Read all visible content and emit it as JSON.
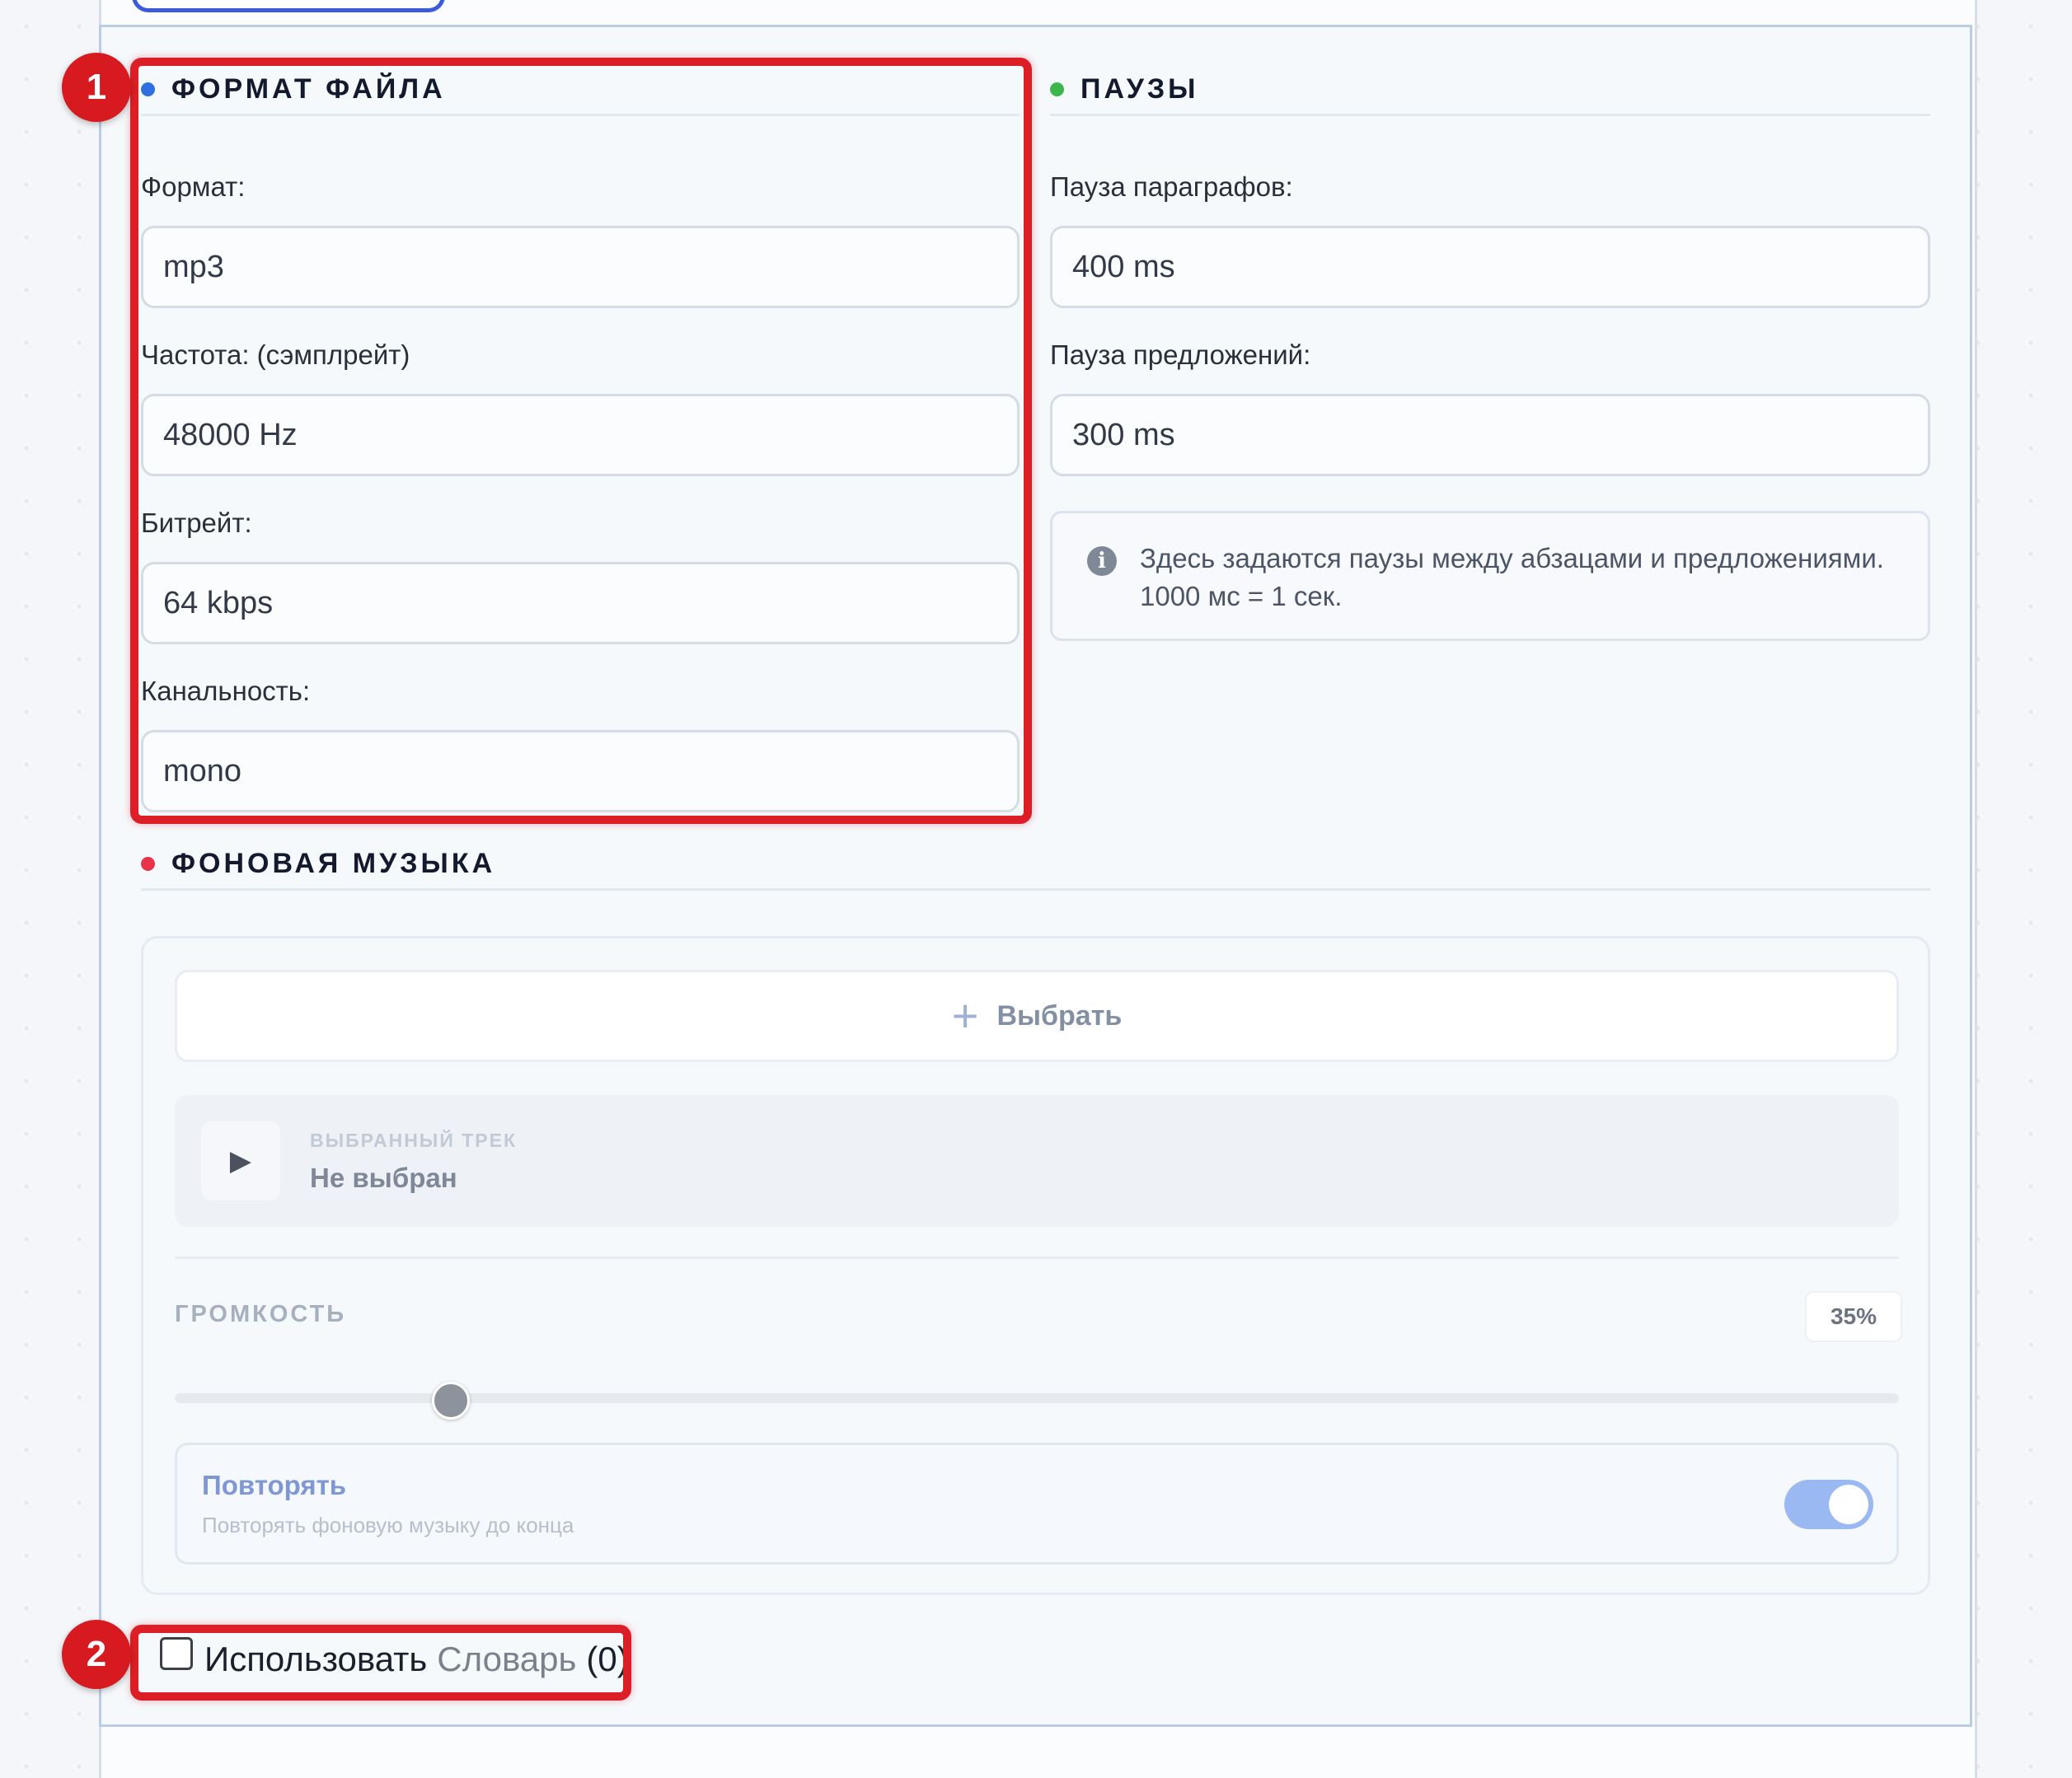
{
  "file_format": {
    "title": "ФОРМАТ ФАЙЛА",
    "dot_color": "#2f6fe0",
    "format_label": "Формат:",
    "format_value": "mp3",
    "samplerate_label": "Частота: (сэмплрейт)",
    "samplerate_value": "48000 Hz",
    "bitrate_label": "Битрейт:",
    "bitrate_value": "64 kbps",
    "channels_label": "Канальность:",
    "channels_value": "mono"
  },
  "pauses": {
    "title": "ПАУЗЫ",
    "dot_color": "#3cb54a",
    "paragraph_label": "Пауза параграфов:",
    "paragraph_value": "400 ms",
    "sentence_label": "Пауза предложений:",
    "sentence_value": "300 ms",
    "info_text": "Здесь задаются паузы между абзацами и предложениями. 1000 мс = 1 сек."
  },
  "background_music": {
    "title": "ФОНОВАЯ МУЗЫКА",
    "dot_color": "#e8344a",
    "choose_label": "Выбрать",
    "track_caption": "ВЫБРАННЫЙ ТРЕК",
    "track_value": "Не выбран",
    "volume_label": "ГРОМКОСТЬ",
    "volume_value": "35%",
    "volume_level": 0.16,
    "repeat_title": "Повторять",
    "repeat_subtitle": "Повторять фоновую музыку до конца",
    "repeat_enabled": true
  },
  "dictionary": {
    "use_label": "Использовать",
    "link_label": "Словарь",
    "count": "(0)",
    "checked": false
  },
  "annotations": {
    "badge_1": "1",
    "badge_2": "2",
    "highlight_color": "#dc1f26"
  }
}
